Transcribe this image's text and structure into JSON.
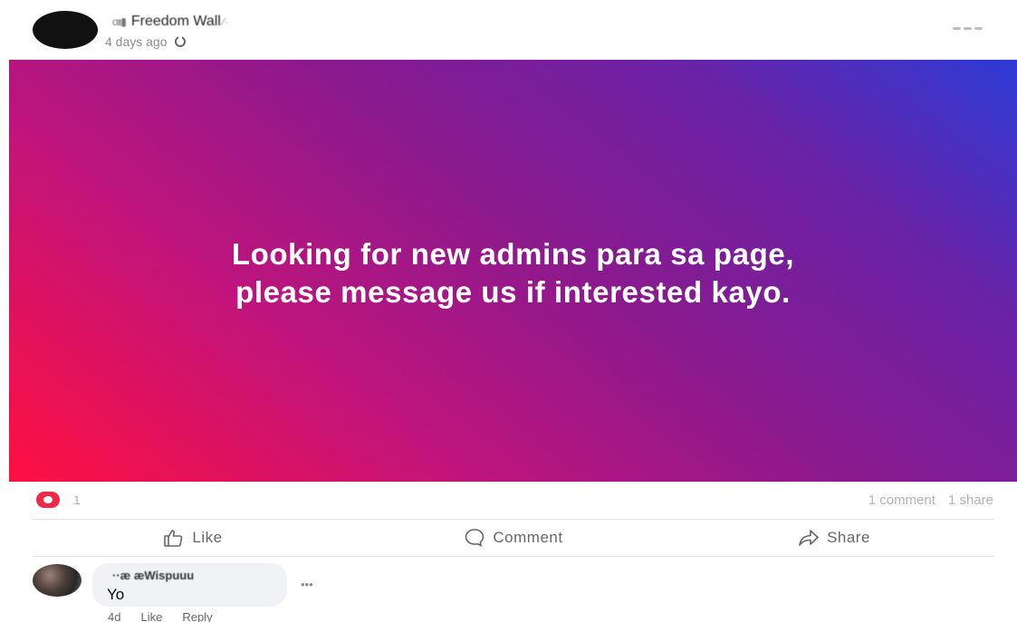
{
  "post": {
    "page_name": "Freedom Wall",
    "page_name_prefix": "αιι▮",
    "page_name_suffix": "∕·",
    "time": "4 days ago",
    "body_line1": "Looking for new admins para sa page,",
    "body_line2": "please message us if interested kayo.",
    "background_colors": [
      "#ff1040",
      "#8a1a8e",
      "#2d3bd6"
    ]
  },
  "stats": {
    "reactions_count": "1",
    "comments": "1 comment",
    "shares": "1 share"
  },
  "actions": {
    "like": "Like",
    "comment": "Comment",
    "share": "Share"
  },
  "comment": {
    "author": "··æ æWispuuu",
    "text": "Yo",
    "time": "4d",
    "like": "Like",
    "reply": "Reply",
    "more": "•••"
  },
  "icons": {
    "avatar": "page-avatar",
    "privacy": "globe-icon",
    "menu": "more-horizontal-icon",
    "reaction": "heart-icon",
    "like": "thumbs-up-icon",
    "comment": "speech-bubble-icon",
    "share": "share-arrow-icon"
  }
}
